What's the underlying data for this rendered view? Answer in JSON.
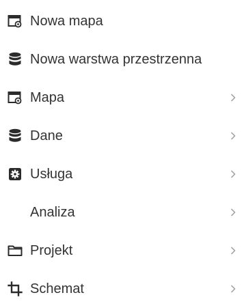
{
  "menu": {
    "items": [
      {
        "label": "Nowa mapa",
        "icon": "map-window-icon",
        "has_submenu": false
      },
      {
        "label": "Nowa warstwa przestrzenna",
        "icon": "database-icon",
        "has_submenu": false
      },
      {
        "label": "Mapa",
        "icon": "map-window-icon",
        "has_submenu": true
      },
      {
        "label": "Dane",
        "icon": "database-icon",
        "has_submenu": true
      },
      {
        "label": "Usługa",
        "icon": "service-gear-icon",
        "has_submenu": true
      },
      {
        "label": "Analiza",
        "icon": "",
        "has_submenu": true
      },
      {
        "label": "Projekt",
        "icon": "folder-icon",
        "has_submenu": true
      },
      {
        "label": "Schemat",
        "icon": "crop-icon",
        "has_submenu": true
      }
    ]
  },
  "colors": {
    "text": "#333333",
    "icon": "#2b2b2b",
    "chevron": "#a0a0a0",
    "background": "#ffffff"
  }
}
